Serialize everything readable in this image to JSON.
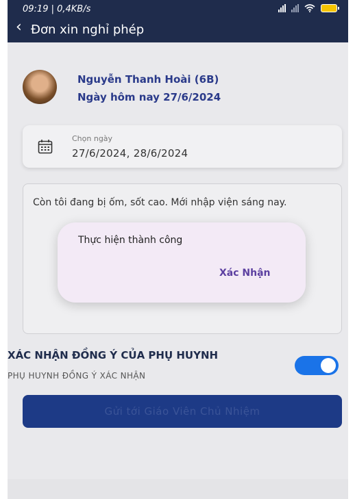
{
  "status_bar": {
    "time": "09:19 | 0,4KB/s",
    "icons": [
      "alarm-icon",
      "signal-icon",
      "signal-icon",
      "wifi-icon",
      "battery-icon"
    ]
  },
  "header": {
    "back_icon": "chevron-left-icon",
    "title": "Đơn xin nghỉ phép"
  },
  "profile": {
    "name": "Nguyễn Thanh Hoài (6B)",
    "today": "Ngày hôm nay 27/6/2024"
  },
  "date_picker": {
    "icon": "calendar-icon",
    "label": "Chọn ngày",
    "value": "27/6/2024, 28/6/2024"
  },
  "reason": {
    "text": "Còn tôi đang bị ốm, sốt cao. Mới nhập viện sáng nay."
  },
  "consent": {
    "title": "XÁC NHẬN ĐỒNG Ý CỦA PHỤ HUYNH",
    "subtitle": "PHỤ HUYNH ĐỒNG Ý XÁC NHẬN",
    "toggle_on": true
  },
  "submit": {
    "label": "Gửi tới Giáo Viên Chủ Nhiệm"
  },
  "dialog": {
    "message": "Thực hiện thành công",
    "confirm_label": "Xác Nhận"
  },
  "colors": {
    "header_bg": "#1f2c4c",
    "accent": "#2a3a8a",
    "toggle": "#1a73e8",
    "button": "#1d3a86",
    "dialog_bg": "#f3eaf6",
    "dialog_button": "#5b3fa0"
  }
}
